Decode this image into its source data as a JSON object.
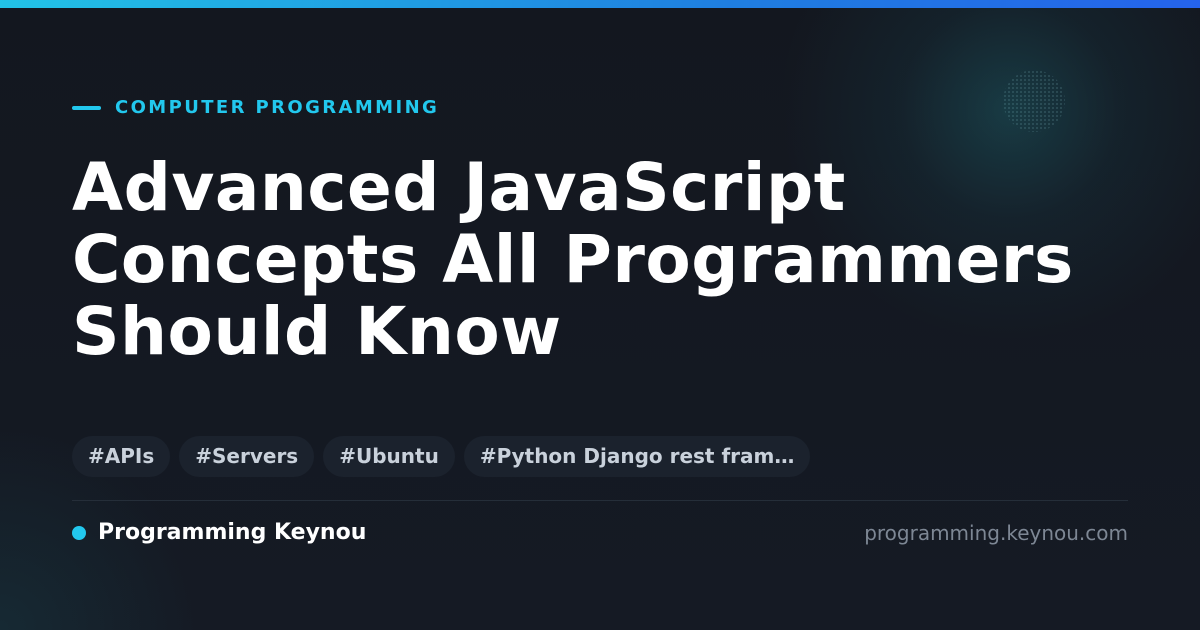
{
  "colors": {
    "accent": "#22c8ee",
    "background": "#141821",
    "title": "#ffffff",
    "tag_background": "#1b222d",
    "tag_text": "#c9d1db",
    "muted": "#7d8794"
  },
  "category": "COMPUTER PROGRAMMING",
  "title_lines": [
    "Advanced JavaScript",
    "Concepts All Programmers",
    "Should Know"
  ],
  "tags": [
    "#APIs",
    "#Servers",
    "#Ubuntu",
    "#Python Django rest fram…"
  ],
  "footer": {
    "brand": "Programming Keynou",
    "url": "programming.keynou.com"
  }
}
